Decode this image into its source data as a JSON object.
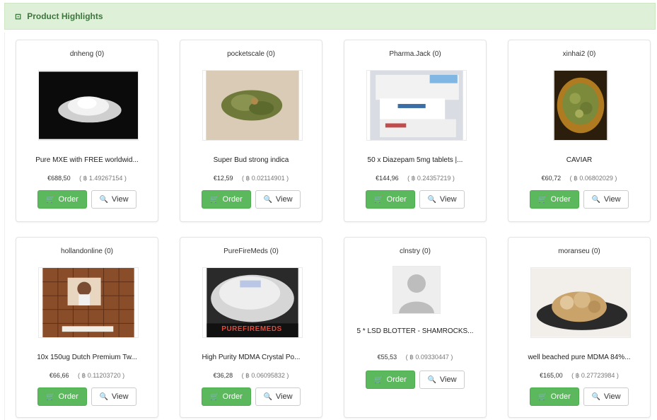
{
  "panel": {
    "icon": "list-icon",
    "icon_glyph": "⊡",
    "title": "Product Highlights"
  },
  "colors": {
    "header_bg": "#dff0d8",
    "header_text": "#3c763d",
    "order_button": "#5cb85c"
  },
  "buttons": {
    "order_label": "Order",
    "view_label": "View",
    "order_icon": "cart-icon",
    "view_icon": "search-icon"
  },
  "products": [
    {
      "vendor": "dnheng (0)",
      "title": "Pure MXE with FREE worldwid...",
      "price": "€688,50",
      "btc": "( ฿ 1.49267154 )",
      "image": "white-powder"
    },
    {
      "vendor": "pocketscale (0)",
      "title": "Super Bud strong indica",
      "price": "€12,59",
      "btc": "( ฿ 0.02114901 )",
      "image": "green-bud"
    },
    {
      "vendor": "Pharma.Jack (0)",
      "title": "50 x Diazepam 5mg tablets |...",
      "price": "€144,96",
      "btc": "( ฿ 0.24357219 )",
      "image": "pill-boxes"
    },
    {
      "vendor": "xinhai2 (0)",
      "title": "CAVIAR",
      "price": "€60,72",
      "btc": "( ฿ 0.06802029 )",
      "image": "bowl-buds"
    },
    {
      "vendor": "hollandonline (0)",
      "title": "10x 150ug Dutch Premium Tw...",
      "price": "€66,66",
      "btc": "( ฿ 0.11203720 )",
      "image": "blotter-sheet"
    },
    {
      "vendor": "PureFireMeds (0)",
      "title": "High Purity MDMA Crystal Po...",
      "price": "€36,28",
      "btc": "( ฿ 0.06095832 )",
      "image": "crystal-powder",
      "watermark": "PUREFIREMEDS"
    },
    {
      "vendor": "clnstry (0)",
      "title": "5 * LSD BLOTTER - SHAMROCKS...",
      "price": "€55,53",
      "btc": "( ฿ 0.09330447 )",
      "image": "placeholder-avatar"
    },
    {
      "vendor": "moranseu (0)",
      "title": "well beached pure MDMA 84%...",
      "price": "€165,00",
      "btc": "( ฿ 0.27723984 )",
      "image": "crystal-rocks"
    }
  ]
}
